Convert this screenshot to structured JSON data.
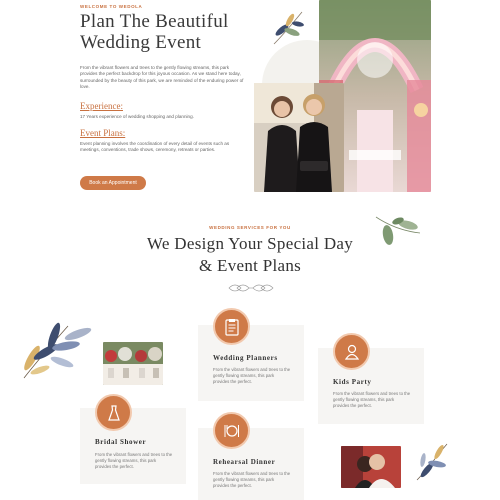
{
  "hero": {
    "eyebrow": "WELCOME TO WEDOLA",
    "title_line1": "Plan The Beautiful",
    "title_line2": "Wedding Event",
    "intro": "From the vibrant flowers and trees to the gently flowing streams, this park provides the perfect backdrop for this joyous occasion. As we stand here today, surrounded by the beauty of this park, we are reminded of the enduring power of love.",
    "experience_heading": "Experience:",
    "experience_text": "17 Years experience of wedding shopping and planning.",
    "event_plans_heading": "Event Plans:",
    "event_plans_text": "Event planning involves the coordination of every detail of events such as meetings, conventions, trade shows, ceremony, retreats or parties.",
    "cta_label": "Book an Appointment"
  },
  "services": {
    "eyebrow": "WEDDING SERVICES FOR YOU",
    "title_line1": "We Design Your Special Day",
    "title_line2": "& Event Plans",
    "cards": [
      {
        "title": "Wedding Planners",
        "text": "From the vibrant flowers and trees to the gently flowing streams, this park provides the perfect.",
        "icon": "clipboard-icon"
      },
      {
        "title": "Kids Party",
        "text": "From the vibrant flowers and trees to the gently flowing streams, this park provides the perfect.",
        "icon": "baby-icon"
      },
      {
        "title": "Bridal Shower",
        "text": "From the vibrant flowers and trees to the gently flowing streams, this park provides the perfect.",
        "icon": "dress-icon"
      },
      {
        "title": "Rehearsal Dinner",
        "text": "From the vibrant flowers and trees to the gently flowing streams, this park provides the perfect.",
        "icon": "dinner-icon"
      }
    ]
  },
  "colors": {
    "accent": "#cf7a48",
    "leaf_green": "#8aa17e",
    "leaf_navy": "#3e4d6f",
    "leaf_gold": "#d9b26a"
  }
}
